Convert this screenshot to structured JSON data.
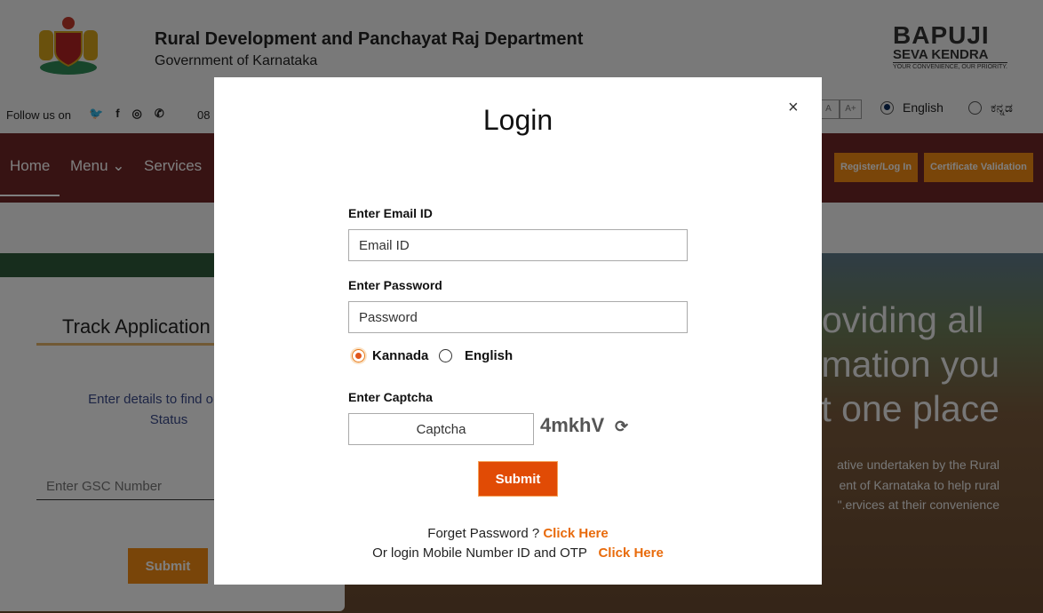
{
  "header": {
    "title": "Rural Development and Panchayat Raj Department",
    "subtitle": "Government of Karnataka",
    "brand": {
      "line1": "BAPUJI",
      "line2": "SEVA KENDRA",
      "tagline": "YOUR CONVENIENCE, OUR PRIORITY."
    }
  },
  "topbar": {
    "follow": "Follow us on",
    "phone": "08",
    "font_sizes": [
      "A",
      "A+"
    ],
    "languages": [
      {
        "label": "English",
        "selected": true
      },
      {
        "label": "ಕನ್ನಡ",
        "selected": false
      }
    ]
  },
  "nav": {
    "items": [
      "Home",
      "Menu ⌄",
      "Services"
    ],
    "buttons": [
      "Register/Log In",
      "Certificate Validation"
    ],
    "color": "#6e2626",
    "button_color": "#f28a12"
  },
  "track": {
    "title": "Track Application",
    "desc": "Enter details to find out you",
    "desc2": "Status",
    "placeholder": "Enter GSC Number",
    "submit": "Submit"
  },
  "hero": {
    "lines": [
      "oviding all",
      "mation you",
      "t one place"
    ],
    "sub": [
      "ative undertaken by the Rural",
      "ent of Karnataka to help rural",
      "ervices at their convenience.\""
    ]
  },
  "modal": {
    "title": "Login",
    "close": "×",
    "email_label": "Enter Email ID",
    "email_placeholder": "Email ID",
    "password_label": "Enter Password",
    "password_placeholder": "Password",
    "lang_options": [
      {
        "label": "Kannada",
        "selected": true
      },
      {
        "label": "English",
        "selected": false
      }
    ],
    "captcha_label": "Enter Captcha",
    "captcha_placeholder": "Captcha",
    "captcha_code": "4mkhV",
    "submit": "Submit",
    "forgot_text": "Forget Password ?",
    "forgot_link": "Click Here",
    "otp_text": "Or login Mobile Number ID and OTP",
    "otp_link": "Click Here",
    "accent": "#e14b05"
  }
}
